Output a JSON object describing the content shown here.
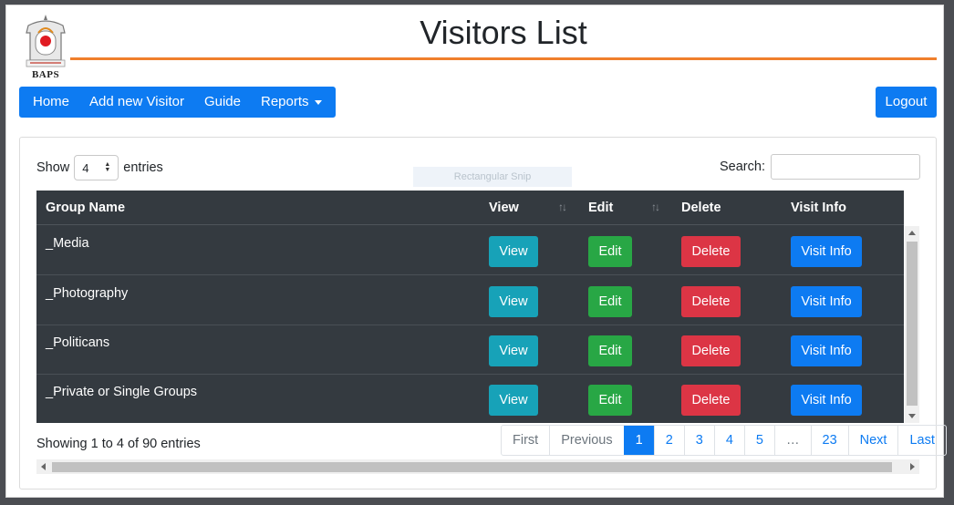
{
  "header": {
    "logo_text": "BAPS",
    "title": "Visitors List",
    "accent_color": "#f07f2c"
  },
  "nav": {
    "items": [
      {
        "label": "Home"
      },
      {
        "label": "Add new Visitor"
      },
      {
        "label": "Guide"
      },
      {
        "label": "Reports",
        "dropdown": true
      }
    ],
    "logout_label": "Logout",
    "color": "#0d7bf2"
  },
  "controls": {
    "show_label": "Show",
    "entries_value": "4",
    "entries_label": "entries",
    "search_label": "Search:",
    "search_value": "",
    "snip_overlay": "Rectangular Snip"
  },
  "table": {
    "columns": [
      "Group Name",
      "View",
      "Edit",
      "Delete",
      "Visit Info"
    ],
    "sort_icon": "sort-arrows",
    "rows": [
      {
        "group": "_Media",
        "view": "View",
        "edit": "Edit",
        "delete": "Delete",
        "visit": "Visit Info"
      },
      {
        "group": "_Photography",
        "view": "View",
        "edit": "Edit",
        "delete": "Delete",
        "visit": "Visit Info"
      },
      {
        "group": "_Politicans",
        "view": "View",
        "edit": "Edit",
        "delete": "Delete",
        "visit": "Visit Info"
      },
      {
        "group": "_Private or Single Groups",
        "view": "View",
        "edit": "Edit",
        "delete": "Delete",
        "visit": "Visit Info"
      }
    ]
  },
  "footer": {
    "info": "Showing 1 to 4 of 90 entries",
    "pagination": [
      "First",
      "Previous",
      "1",
      "2",
      "3",
      "4",
      "5",
      "…",
      "23",
      "Next",
      "Last"
    ],
    "active_page": "1"
  }
}
